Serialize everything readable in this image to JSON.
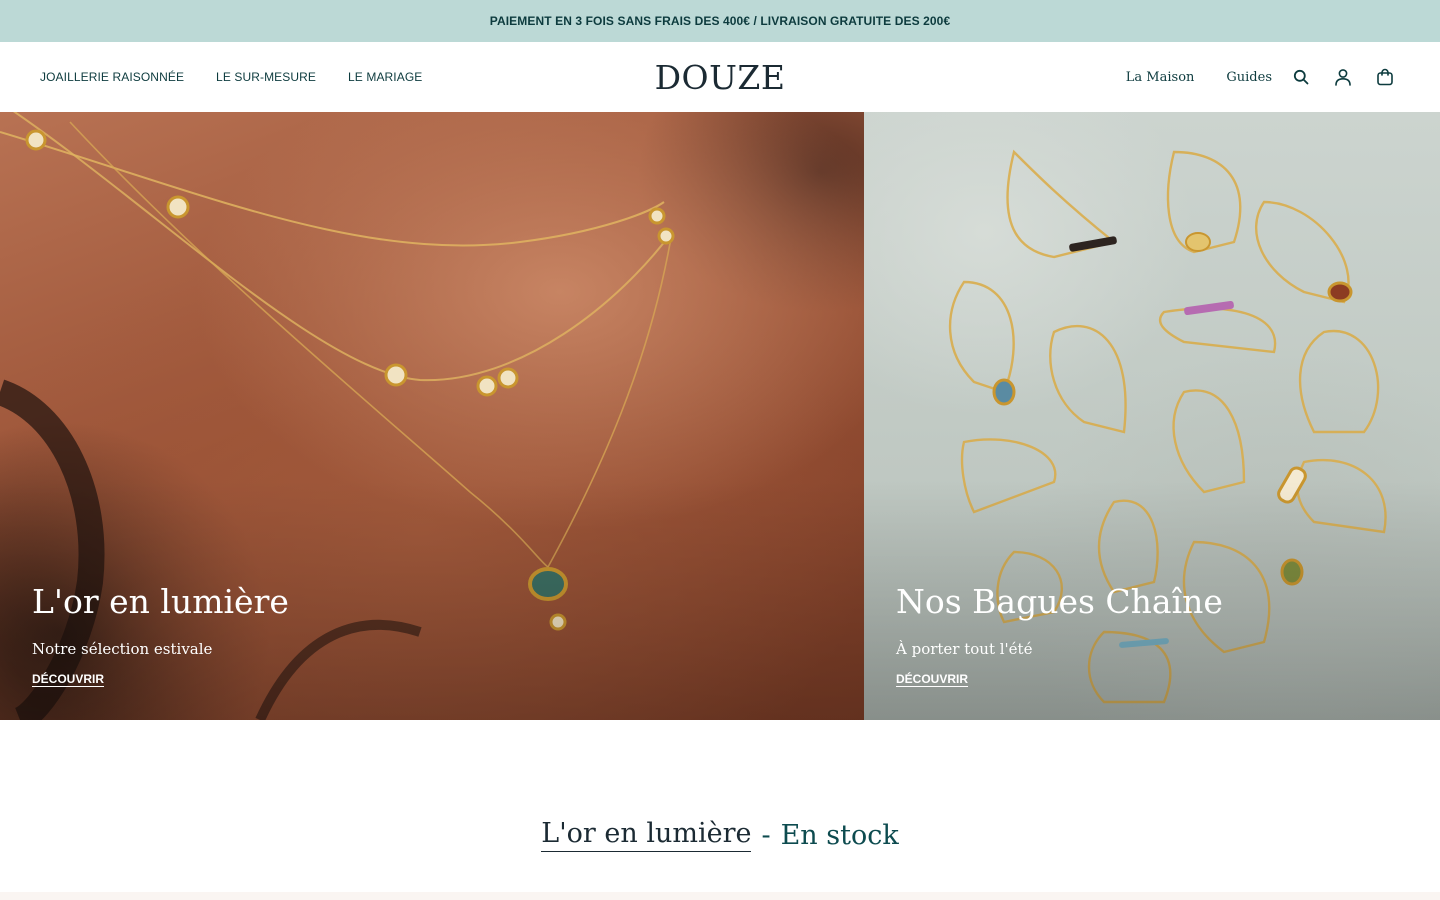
{
  "announcement": "PAIEMENT EN 3 FOIS SANS FRAIS DES 400€ / LIVRAISON GRATUITE DES 200€",
  "header": {
    "logo": "DOUZE",
    "nav_left": [
      "JOAILLERIE RAISONNÉE",
      "LE SUR-MESURE",
      "LE MARIAGE"
    ],
    "nav_right": {
      "maison": "La Maison",
      "guides": "Guides"
    },
    "icons": [
      "search-icon",
      "account-icon",
      "bag-icon"
    ]
  },
  "heroes": [
    {
      "title": "L'or en lumière",
      "subtitle": "Notre sélection estivale",
      "cta": "DÉCOUVRIR"
    },
    {
      "title": "Nos Bagues Chaîne",
      "subtitle": "À porter tout l'été",
      "cta": "DÉCOUVRIR"
    }
  ],
  "section": {
    "title": "L'or en lumière",
    "separator": "-",
    "tag": "En stock"
  },
  "colors": {
    "announcement_bg": "#bcd9d6",
    "brand_text": "#0d3b3e",
    "accent_teal": "#0d4b4f"
  }
}
